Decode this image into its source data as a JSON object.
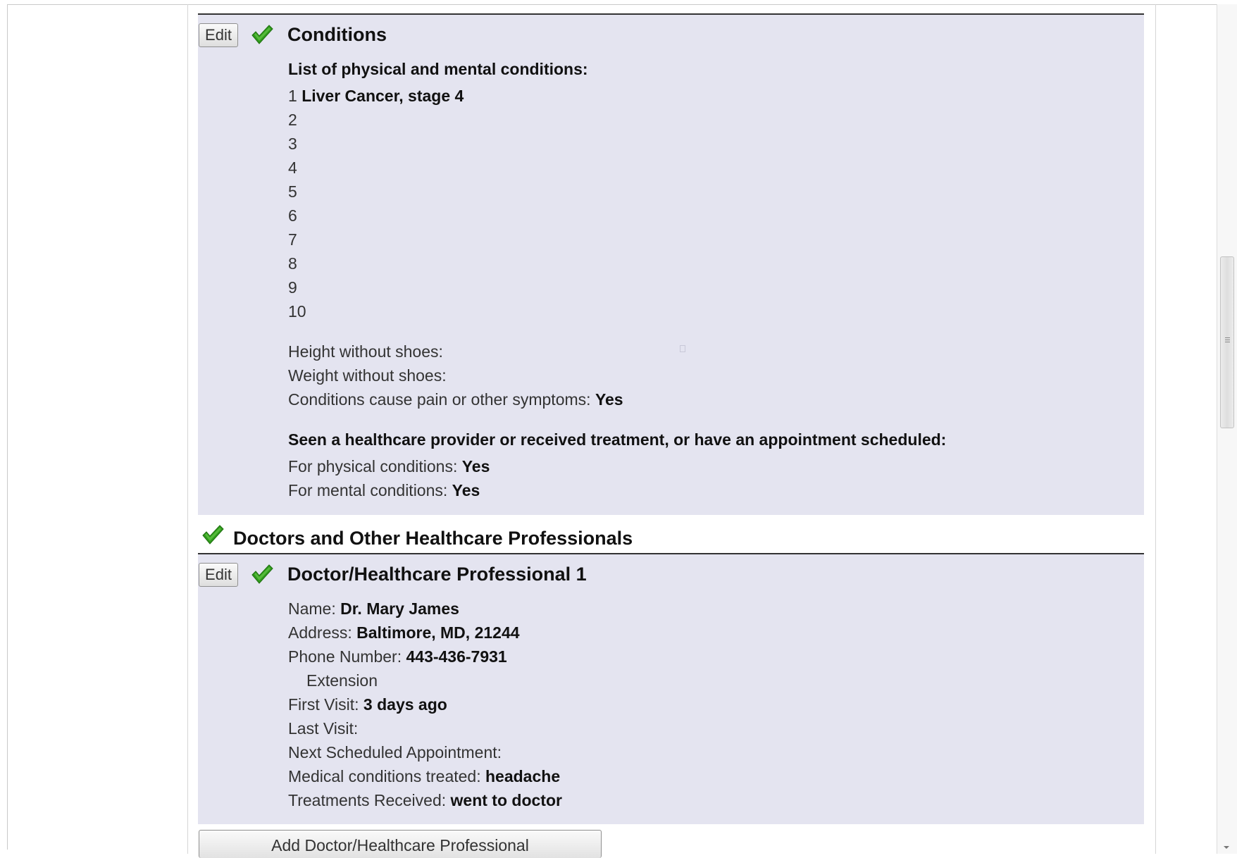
{
  "conditions": {
    "edit_label": "Edit",
    "title": "Conditions",
    "list_heading": "List of physical and mental conditions:",
    "items": [
      {
        "num": "1",
        "text": "Liver Cancer, stage 4"
      },
      {
        "num": "2",
        "text": ""
      },
      {
        "num": "3",
        "text": ""
      },
      {
        "num": "4",
        "text": ""
      },
      {
        "num": "5",
        "text": ""
      },
      {
        "num": "6",
        "text": ""
      },
      {
        "num": "7",
        "text": ""
      },
      {
        "num": "8",
        "text": ""
      },
      {
        "num": "9",
        "text": ""
      },
      {
        "num": "10",
        "text": ""
      }
    ],
    "height_label": "Height without shoes:",
    "weight_label": "Weight without shoes:",
    "pain_label": "Conditions cause pain or other symptoms:",
    "pain_value": "Yes",
    "seen_heading": "Seen a healthcare provider or received treatment, or have an appointment scheduled:",
    "physical_label": "For physical conditions:",
    "physical_value": "Yes",
    "mental_label": "For mental conditions:",
    "mental_value": "Yes"
  },
  "doctors_section": {
    "title": "Doctors and Other Healthcare Professionals"
  },
  "doctor1": {
    "edit_label": "Edit",
    "title": "Doctor/Healthcare Professional 1",
    "name_label": "Name:",
    "name_value": "Dr. Mary James",
    "address_label": "Address:",
    "address_value": "Baltimore, MD, 21244",
    "phone_label": "Phone Number:",
    "phone_value": "443-436-7931",
    "extension_label": "Extension",
    "first_visit_label": "First Visit:",
    "first_visit_value": "3 days ago",
    "last_visit_label": "Last Visit:",
    "next_appt_label": "Next Scheduled Appointment:",
    "conditions_treated_label": "Medical conditions treated:",
    "conditions_treated_value": "headache",
    "treatments_label": "Treatments Received:",
    "treatments_value": "went to doctor"
  },
  "add_doctor_button": "Add Doctor/Healthcare Professional",
  "colors": {
    "panel_bg": "#e4e4f0",
    "check_green": "#2f9a1c",
    "rule": "#333333"
  }
}
